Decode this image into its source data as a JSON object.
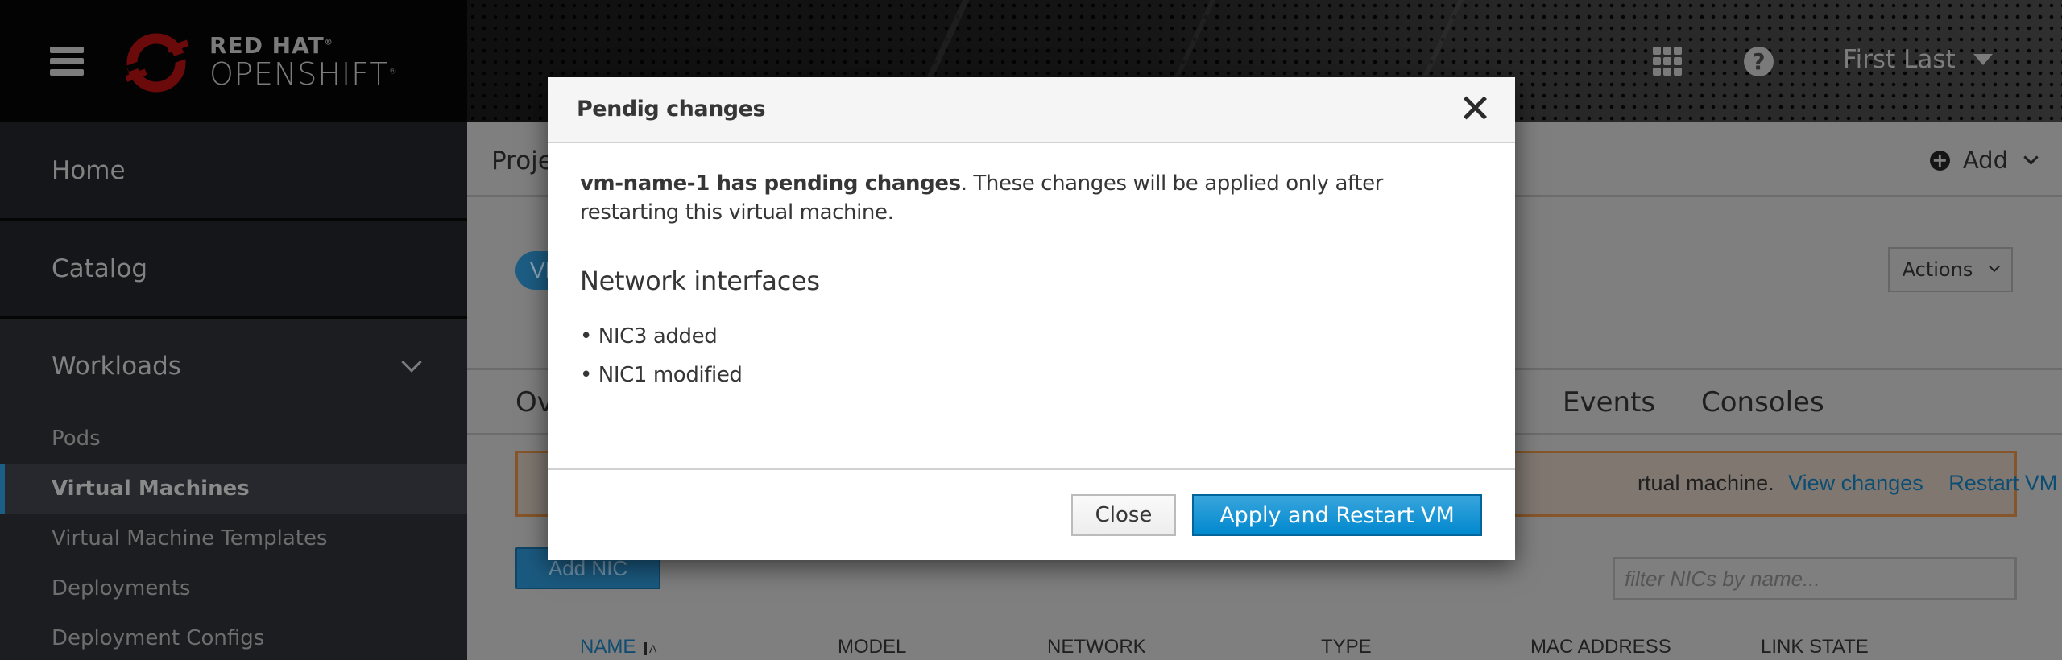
{
  "masthead": {
    "brand_line1": "RED HAT",
    "brand_line2": "OPENSHIFT",
    "brand_reg": "®",
    "help_glyph": "?",
    "user_name": "First Last"
  },
  "sidebar": {
    "top_items": [
      {
        "label": "Home"
      },
      {
        "label": "Catalog"
      }
    ],
    "section": {
      "label": "Workloads",
      "expanded": true
    },
    "sub_items": [
      {
        "label": "Pods",
        "active": false
      },
      {
        "label": "Virtual Machines",
        "active": true
      },
      {
        "label": "Virtual Machine Templates",
        "active": false
      },
      {
        "label": "Deployments",
        "active": false
      },
      {
        "label": "Deployment Configs",
        "active": false
      }
    ]
  },
  "main": {
    "project_label": "Proje",
    "add_menu_label": "Add",
    "vm_badge": "VM",
    "actions_label": "Actions",
    "tabs": [
      {
        "label": "Ov"
      },
      {
        "label": "Events"
      },
      {
        "label": "Consoles"
      }
    ],
    "alert": {
      "text": "rtual machine.",
      "links": [
        "View changes",
        "Restart VM"
      ]
    },
    "add_nic_label": "Add NIC",
    "filter_placeholder": "filter NICs by name...",
    "table_headers": [
      "NAME",
      "MODEL",
      "NETWORK",
      "TYPE",
      "MAC ADDRESS",
      "LINK STATE"
    ],
    "sorted_column": "NAME"
  },
  "modal": {
    "title": "Pendig changes",
    "message_bold": "vm-name-1 has pending changes",
    "message_rest": ". These changes will be applied only after restarting this virtual machine.",
    "section_title": "Network interfaces",
    "changes": [
      "• NIC3 added",
      "• NIC1 modified"
    ],
    "close_label": "Close",
    "apply_label": "Apply and Restart VM"
  },
  "colors": {
    "primary_button": "#0088ce",
    "link": "#0b4d73",
    "alert_border": "#86562a",
    "active_nav_indicator": "#1b5f86"
  }
}
